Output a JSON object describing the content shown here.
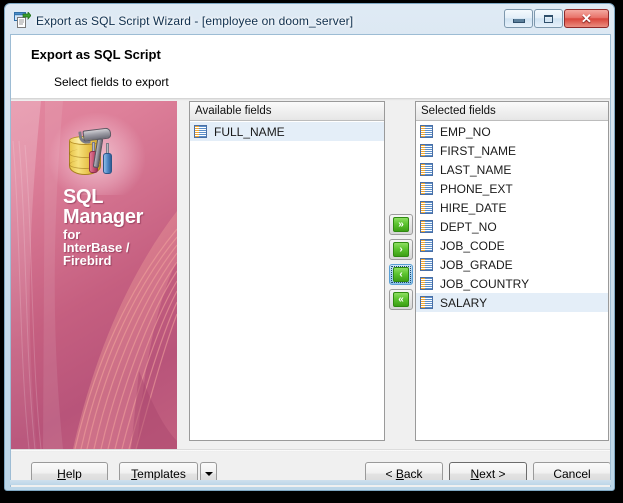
{
  "window": {
    "title": "Export as SQL Script Wizard - [employee on doom_server]",
    "icon": "export-document-icon",
    "buttons": {
      "minimize": "minimize-button",
      "maximize": "maximize-button",
      "close": "✕"
    }
  },
  "header": {
    "title": "Export as SQL Script",
    "subtitle": "Select fields to export"
  },
  "branding": {
    "product_line1": "SQL",
    "product_line2": "Manager",
    "product_line3": "for",
    "product_line4": "InterBase /",
    "product_line5": "Firebird",
    "logo_icon": "database-tools-icon",
    "accent_color": "#c55f80"
  },
  "available": {
    "header": "Available fields",
    "items": [
      {
        "label": "FULL_NAME",
        "selected": true
      }
    ]
  },
  "selected": {
    "header": "Selected fields",
    "items": [
      {
        "label": "EMP_NO",
        "selected": false
      },
      {
        "label": "FIRST_NAME",
        "selected": false
      },
      {
        "label": "LAST_NAME",
        "selected": false
      },
      {
        "label": "PHONE_EXT",
        "selected": false
      },
      {
        "label": "HIRE_DATE",
        "selected": false
      },
      {
        "label": "DEPT_NO",
        "selected": false
      },
      {
        "label": "JOB_CODE",
        "selected": false
      },
      {
        "label": "JOB_GRADE",
        "selected": false
      },
      {
        "label": "JOB_COUNTRY",
        "selected": false
      },
      {
        "label": "SALARY",
        "selected": true
      }
    ]
  },
  "transfer": {
    "move_all_right": "»",
    "move_right": "›",
    "move_left": "‹",
    "move_all_left": "«"
  },
  "footer": {
    "help": "Help",
    "help_mnemonic": "H",
    "templates": "Templates",
    "templates_mnemonic": "T",
    "back": "< Back",
    "back_mnemonic": "B",
    "next": "Next >",
    "next_mnemonic": "N",
    "cancel": "Cancel"
  }
}
